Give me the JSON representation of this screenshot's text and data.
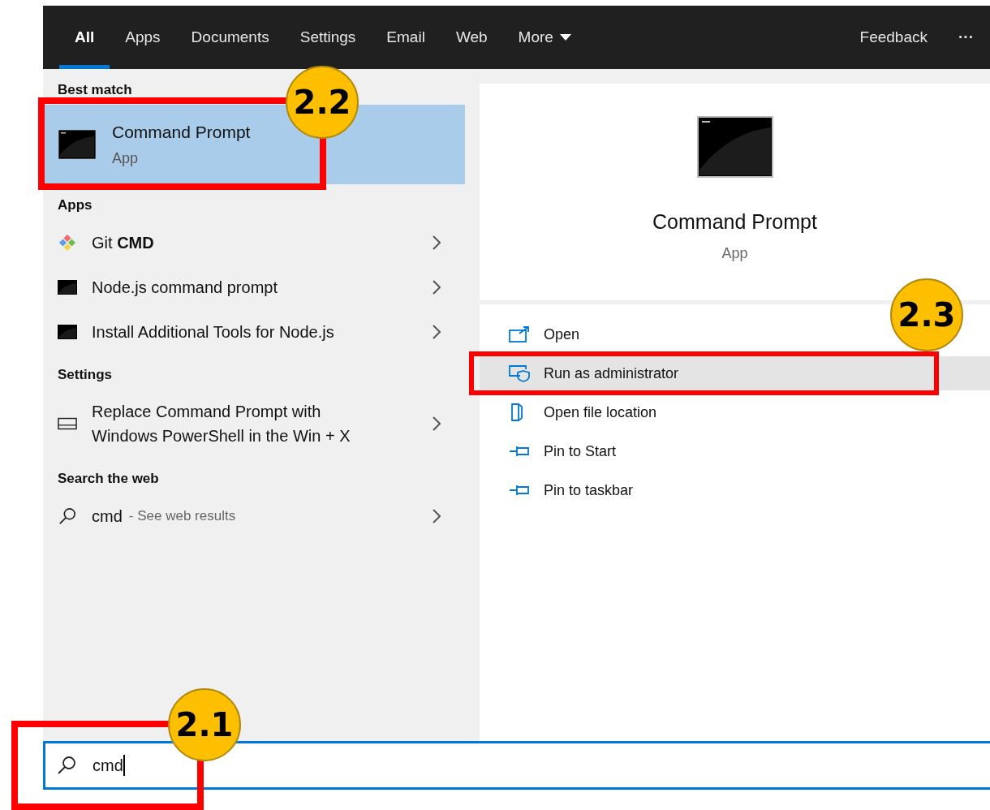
{
  "tabs": [
    {
      "label": "All",
      "selected": true
    },
    {
      "label": "Apps",
      "selected": false
    },
    {
      "label": "Documents",
      "selected": false
    },
    {
      "label": "Settings",
      "selected": false
    },
    {
      "label": "Email",
      "selected": false
    },
    {
      "label": "Web",
      "selected": false
    },
    {
      "label": "More",
      "selected": false,
      "dropdown": true
    }
  ],
  "feedback": "Feedback",
  "more_options": "···",
  "sections": [
    {
      "heading": "Best match",
      "items": [
        {
          "kind": "best",
          "title": "Command Prompt",
          "subtitle": "App",
          "selected": true
        }
      ]
    },
    {
      "heading": "Apps",
      "items": [
        {
          "kind": "git",
          "title": "Git **CMD**",
          "selected": false
        },
        {
          "kind": "console",
          "title": "Node.js command prompt",
          "selected": false
        },
        {
          "kind": "console",
          "title": "Install Additional Tools for Node.js",
          "selected": false
        }
      ]
    },
    {
      "heading": "Settings",
      "items": [
        {
          "kind": "setting",
          "title": "Replace Command Prompt with Windows PowerShell in the Win + X",
          "selected": false
        }
      ]
    },
    {
      "heading": "Search the web",
      "items": [
        {
          "kind": "web",
          "title": "cmd",
          "hint": "- See web results",
          "selected": false
        }
      ]
    }
  ],
  "detail": {
    "title": "Command Prompt",
    "subtitle": "App"
  },
  "actions": [
    {
      "kind": "open",
      "label": "Open",
      "highlighted": false
    },
    {
      "kind": "admin",
      "label": "Run as administrator",
      "highlighted": true
    },
    {
      "kind": "file",
      "label": "Open file location",
      "highlighted": false
    },
    {
      "kind": "pin",
      "label": "Pin to Start",
      "highlighted": false
    },
    {
      "kind": "pin",
      "label": "Pin to taskbar",
      "highlighted": false
    }
  ],
  "search": {
    "value": "cmd"
  },
  "annotations": [
    {
      "label": "2.2"
    },
    {
      "label": "2.3"
    },
    {
      "label": "2.1"
    }
  ]
}
